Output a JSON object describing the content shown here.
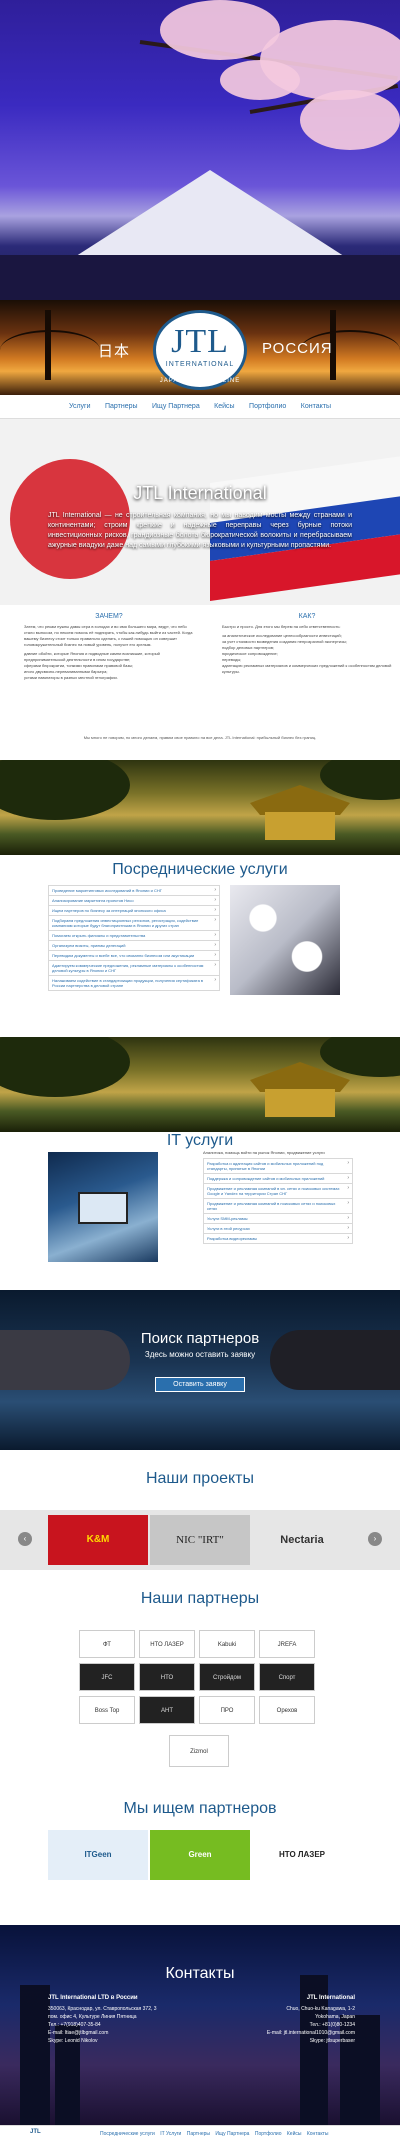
{
  "brand": {
    "logo_text": "JTL",
    "logo_sub": "INTERNATIONAL",
    "left_text": "日本",
    "right_text": "РОССИЯ",
    "tagline": "JAPAN TRADING LINE"
  },
  "nav": {
    "items": [
      "Услуги",
      "Партнеры",
      "Ищу Партнера",
      "Кейсы",
      "Портфолио",
      "Контакты"
    ]
  },
  "intro": {
    "title": "JTL International",
    "text": "JTL International — не строительная компания, но мы наводим мосты между странами и континентами; строим крепкие и надежные переправы через бурные потоки инвестиционных рисков, гранд­иозные болота бюрократической волокиты и перебрасываем ажурные виадуки даже над самыми глубокими языковыми и культурными пропастями."
  },
  "why_how": {
    "why_title": "ЗАЧЕМ?",
    "why_text": "Затем, что рекам нужны дамы сера в холодах и во имя большего мира, ведут, что небо стало выносом, но некоем помочь её подпирать, чтобы как-нибудь выйти из частей. Когда вашему бизнесу стоит только правильно сделать, с нашей помощью он совершит головокружительный бизнес на новый уровень, получит его зрелым.",
    "why_items": [
      "давние обойти, которые Япония и подводные камни возникшие, который предпринимательской деятельности в ином государстве;",
      "сферами бюрократии, тонкими правилами правовой базы;",
      "иного двусвязно-переваливанными барьера;",
      "устами навигаторы в разных местной этнографии."
    ],
    "how_title": "КАК?",
    "how_text": "Быстро и просто. Для этого мы берем на себя ответственность:",
    "how_items": [
      "за аналитическое исследование целесообразности инвестиций;",
      "за учет стоимости возведения создания непрозрачной экспертизы;",
      "подбор деловых партнеров;",
      "юридическое сопровождение;",
      "переводы;",
      "адаптацию рекламных материалов и коммерческих предложений к особенностям деловой культуры."
    ],
    "note": "Мы много не говорим, но много делаем, правим свое правило на все дела. JTL International: прибыльный бизнес без границ."
  },
  "intermediary": {
    "title": "Посреднические услуги",
    "items": [
      "Проведение маркетинговых исследований в Японии и СНГ",
      "Анализирование маркетинга проектов Нисо",
      "Ищем партнеров по бизнесу за интернаций японского офиса",
      "Подбираем предложения инвестиционных регионов, регистрация, содействие компаниям которые будут благоприятными в Японии и других стран",
      "Помогаем открыть филиалы и представительства",
      "Организуем визиты, приемы делегаций",
      "Переводим документы и всебе все, что связанно бизнесом или акустикации",
      "Адаптируем коммерческие предложения, рекламные материалы к особенностям деловой культуры в Японии и СНГ",
      "Налаживаем содействие в стандартизации продукции, получения сертификата в России партнерства в деловой стране"
    ]
  },
  "it": {
    "title": "IT услуги",
    "intro": "Аналитика, помощь войти на рынок Японии, продвижение услуги",
    "items": [
      "Разработка и адаптация сайтов и мобильных приложений под стандарты, принятые в Японии",
      "Поддержка и сопровождение сайтов и мобильных приложений",
      "Продвижение и рекламная компаний в яп. сетях и поисковых системах Google и Yandex на территории Стран СНГ",
      "Продвижение и рекламная компаний в поисковых сетях и поисковых сетях",
      "Услуги SMM-рекламы",
      "Услуги в этой ресурсах",
      "Разработка видеорекламы"
    ]
  },
  "search": {
    "title": "Поиск партнеров",
    "subtitle": "Здесь можно оставить заявку",
    "button": "Оставить заявку"
  },
  "projects": {
    "title": "Наши проекты",
    "items": [
      "K&M",
      "NIC \"IRT\"",
      "Nectaria"
    ],
    "arrow_left": "‹",
    "arrow_right": "›"
  },
  "partners": {
    "title": "Наши партнеры",
    "logos": [
      "ФТ",
      "НТО ЛАЗЕР",
      "Kabuki",
      "JREFA",
      "JFC",
      "НТО",
      "Стройдом",
      "Спорт",
      "Boss Top",
      "АНТ",
      "ПРО",
      "Орехов",
      "Zizmol"
    ]
  },
  "seeking": {
    "title": "Мы ищем партнеров",
    "items": [
      "ITGeen",
      "Green",
      "НТО ЛАЗЕР"
    ]
  },
  "contacts": {
    "title": "Контакты",
    "left_head": "JTL International LTD в России",
    "left_lines": [
      "350063, Краснодар, ул. Ставропольская 372, 3",
      "пом. офис 4, Культуре Линия Пятница",
      "Тел.: +7(918)407-35-84",
      "E-mail: ltiae@jtlbgmail.com",
      "Skype: Leonid Nikolov"
    ],
    "right_head": "JTL International",
    "right_lines": [
      "Chuo, Chuo-ku Kanagawa, 1-2",
      "Yokohama, Japan",
      "Тел.: +81(0)80-1234",
      "E-mail: jtl.international1010@gmail.com",
      "Skype: jtlsuperbaser"
    ]
  },
  "footer": {
    "logo": "JTL",
    "nav": [
      "Посреднические услуги",
      "IT Услуги",
      "Партнеры",
      "Ищу Партнера",
      "Портфолио",
      "Кейсы",
      "Контакты"
    ]
  }
}
